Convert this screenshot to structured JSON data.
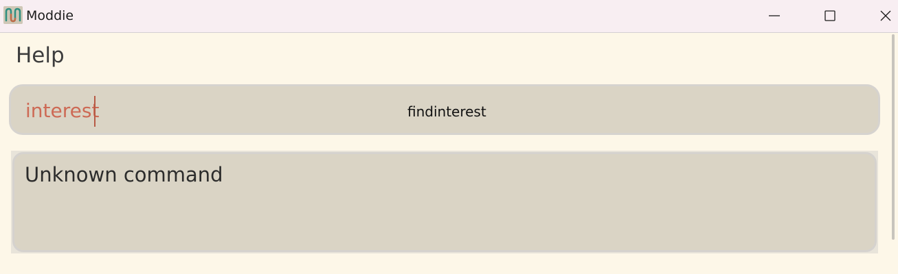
{
  "window": {
    "title": "Moddie",
    "app_icon": "moddie-logo-icon",
    "controls": {
      "minimize_icon": "minimize-icon",
      "maximize_icon": "maximize-icon",
      "close_icon": "close-icon"
    }
  },
  "main": {
    "heading": "Help",
    "command_box": {
      "value": "interest",
      "suggestion": "findinterest",
      "text_color": "#cd6a55"
    },
    "result_box": {
      "text": "Unknown command"
    }
  },
  "colors": {
    "background": "#fdf7e8",
    "titlebar": "#f8eef2",
    "box_fill": "#dad4c5",
    "accent": "#cd6a55"
  }
}
